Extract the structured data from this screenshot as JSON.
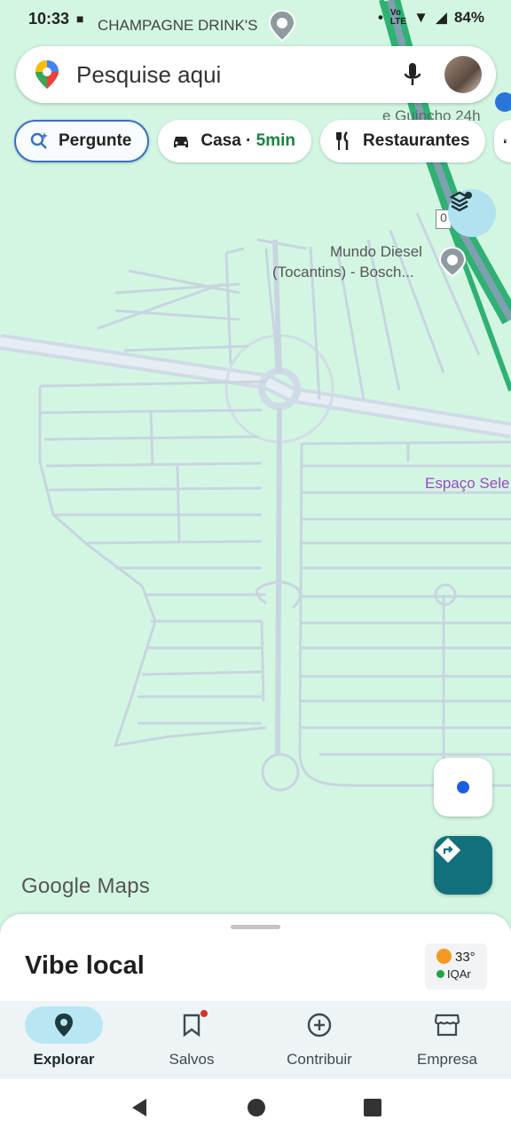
{
  "status": {
    "time": "10:33",
    "poi": "CHAMPAGNE DRINK'S",
    "battery": "84%",
    "net_top": "Vo",
    "net_bottom": "LTE"
  },
  "search": {
    "placeholder": "Pesquise aqui"
  },
  "chips": [
    {
      "label": "Pergunte"
    },
    {
      "label": "Casa",
      "sep": " · ",
      "eta": "5min"
    },
    {
      "label": "Restaurantes"
    }
  ],
  "map": {
    "labels": {
      "poi_diesel_line1": "Mundo Diesel",
      "poi_diesel_line2": "(Tocantins) - Bosch...",
      "poi_espaco": "Espaço Sele",
      "poi_guincho": "e Guincho 24h",
      "road_shield": "0"
    },
    "logo": "Google Maps"
  },
  "sheet": {
    "title": "Vibe local",
    "temperature": "33°",
    "aqi": "IQAr"
  },
  "nav": [
    {
      "label": "Explorar",
      "icon": "explore-pin-icon"
    },
    {
      "label": "Salvos",
      "icon": "bookmark-icon"
    },
    {
      "label": "Contribuir",
      "icon": "add-circle-icon"
    },
    {
      "label": "Empresa",
      "icon": "storefront-icon"
    }
  ],
  "colors": {
    "map_bg": "#d3f6e3",
    "accent_teal": "#11707c",
    "highway": "#2fb173",
    "purple_label": "#9a48c9"
  }
}
